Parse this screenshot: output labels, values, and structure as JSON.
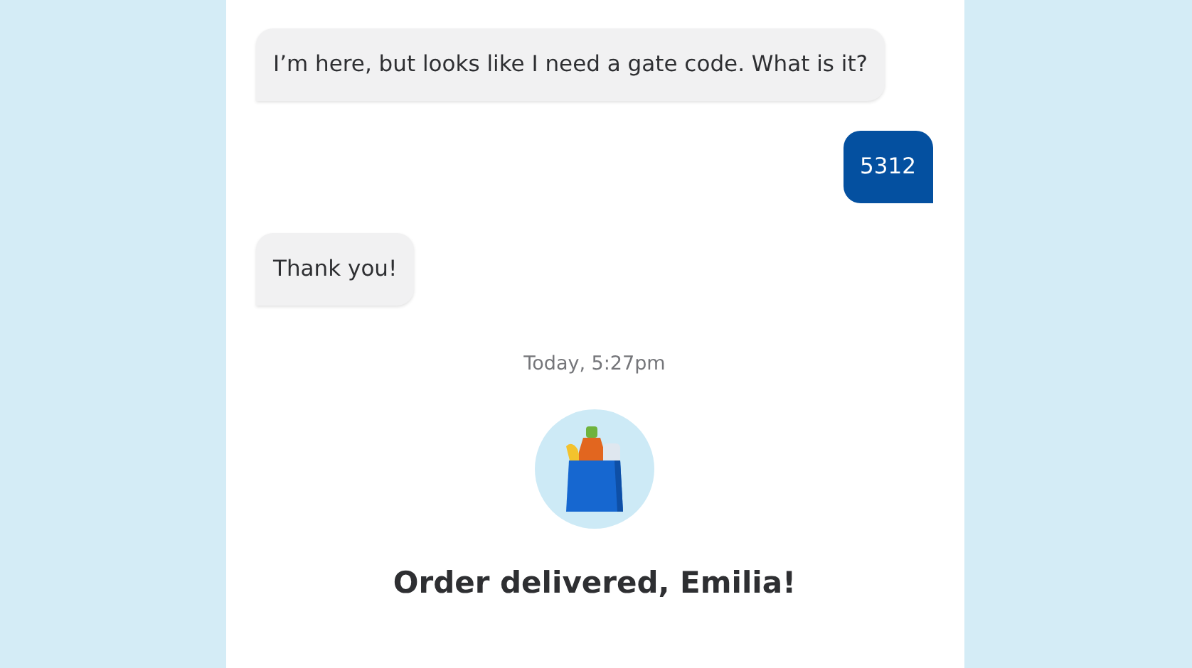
{
  "messages": [
    {
      "kind": "incoming",
      "text": "I’m here, but looks like I need a gate code. What is it?"
    },
    {
      "kind": "outgoing",
      "text": "5312"
    },
    {
      "kind": "incoming",
      "text": "Thank you!"
    }
  ],
  "timestamp": "Today, 5:27pm",
  "status": {
    "title": "Order delivered, Emilia!"
  }
}
